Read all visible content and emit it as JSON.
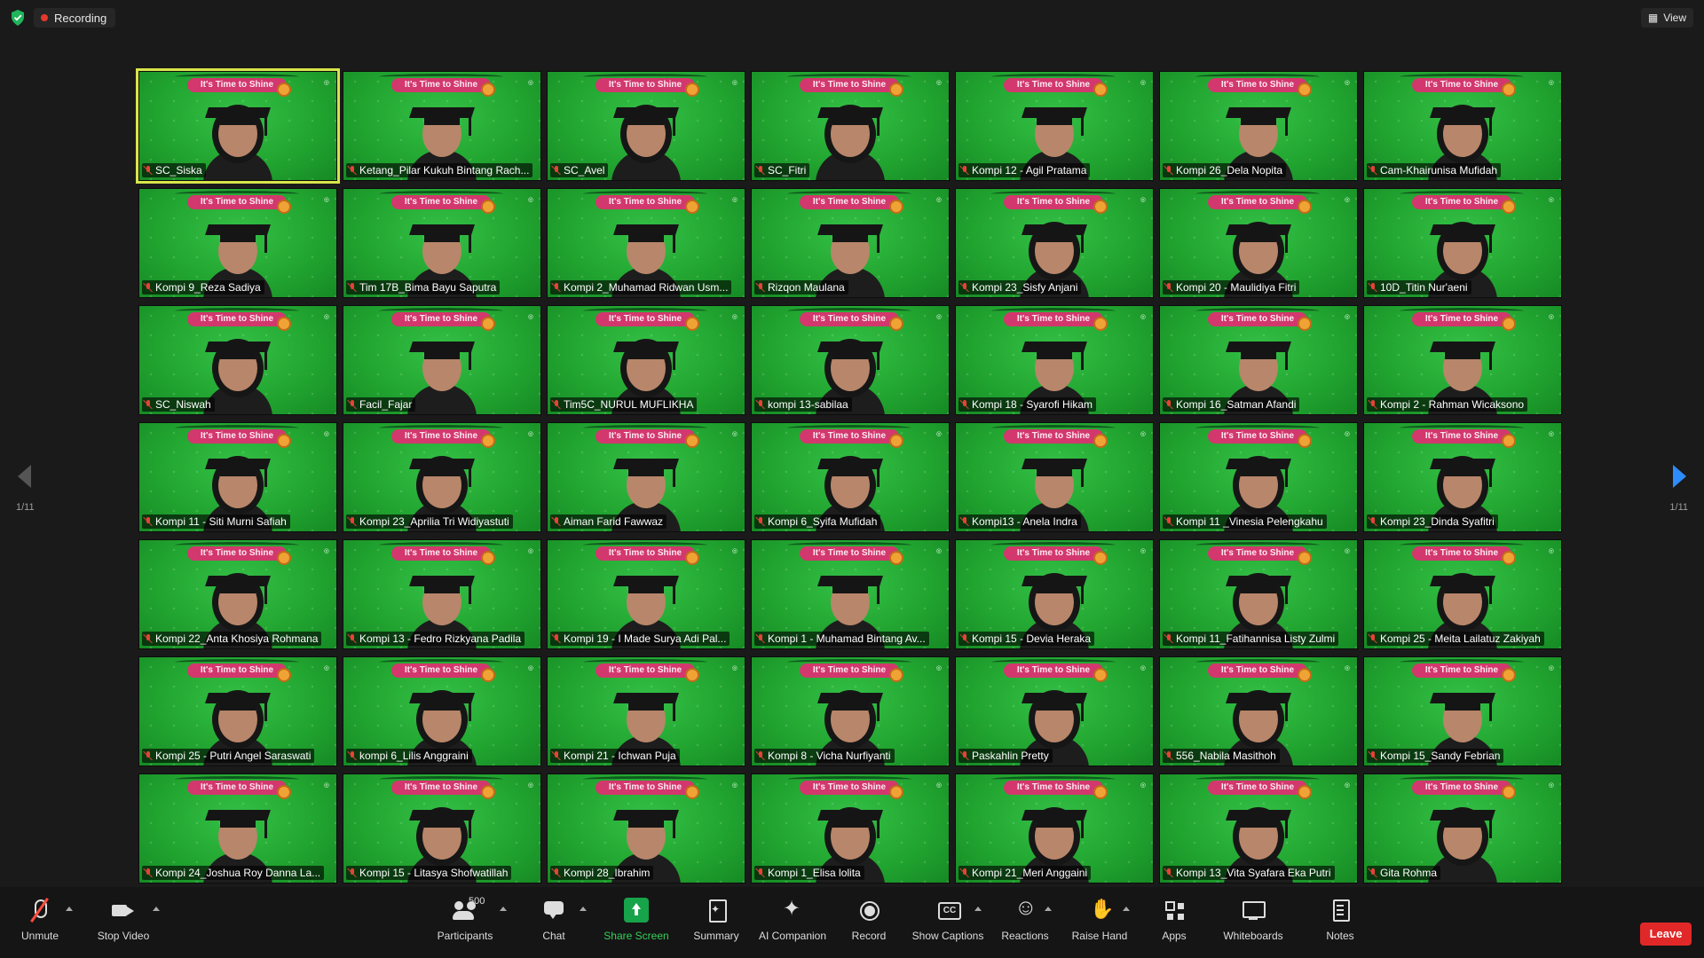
{
  "topbar": {
    "recording_label": "Recording",
    "view_label": "View",
    "shield_icon": "security-shield-icon",
    "view_icon": "grid-view-icon"
  },
  "pagination": {
    "left": "1/11",
    "right": "1/11"
  },
  "banner_text": "It's Time to Shine",
  "participants": [
    "SC_Siska",
    "Ketang_Pilar Kukuh Bintang Rach...",
    "SC_Avel",
    "SC_Fitri",
    "Kompi 12 - Agil Pratama",
    "Kompi 26_Dela Nopita",
    "Cam-Khairunisa Mufidah",
    "Kompi 9_Reza Sadiya",
    "Tim 17B_Bima Bayu Saputra",
    "Kompi 2_Muhamad Ridwan Usm...",
    "Rizqon Maulana",
    "Kompi 23_Sisfy Anjani",
    "Kompi 20 - Maulidiya Fitri",
    "10D_Titin Nur'aeni",
    "SC_Niswah",
    "Facil_Fajar",
    "Tim5C_NURUL MUFLIKHA",
    "kompi 13-sabilaa",
    "Kompi 18 - Syarofi Hikam",
    "Kompi 16_Satman Afandi",
    "Kompi 2 - Rahman Wicaksono",
    "Kompi 11 - Siti Murni Safiah",
    "Kompi 23_Aprilia Tri Widiyastuti",
    "Aiman Farid Fawwaz",
    "Kompi 6_Syifa Mufidah",
    "Kompi13 - Anela Indra",
    "Kompi 11 _Vinesia Pelengkahu",
    "Kompi 23_Dinda Syafitri",
    "Kompi 22_Anta Khosiya Rohmana",
    "Kompi 13 - Fedro Rizkyana Padila",
    "Kompi 19 - I Made Surya Adi Pal...",
    "Kompi 1 - Muhamad Bintang Av...",
    "Kompi 15 - Devia Heraka",
    "Kompi 11_Fatihannisa Listy Zulmi",
    "Kompi 25 - Meita Lailatuz Zakiyah",
    "Kompi 25 - Putri Angel Saraswati",
    "kompi 6_Lilis Anggraini",
    "Kompi 21 - Ichwan Puja",
    "Kompi 8 - Vicha Nurfiyanti",
    "Paskahlin Pretty",
    "556_Nabila Masithoh",
    "Kompi 15_Sandy Febrian",
    "Kompi 24_Joshua Roy Danna La...",
    "Kompi 15 - Litasya Shofwatillah",
    "Kompi 28_Ibrahim",
    "Kompi 1_Elisa lolita",
    "Kompi 21_Meri Anggaini",
    "Kompi 13_Vita Syafara Eka Putri",
    "Gita Rohma"
  ],
  "toolbar": {
    "unmute": "Unmute",
    "stop_video": "Stop Video",
    "participants_count": "500",
    "participants": "Participants",
    "chat": "Chat",
    "share_screen": "Share Screen",
    "summary": "Summary",
    "ai_companion": "AI Companion",
    "record": "Record",
    "show_captions": "Show Captions",
    "reactions": "Reactions",
    "raise_hand": "Raise Hand",
    "apps": "Apps",
    "whiteboards": "Whiteboards",
    "notes": "Notes",
    "leave": "Leave"
  }
}
